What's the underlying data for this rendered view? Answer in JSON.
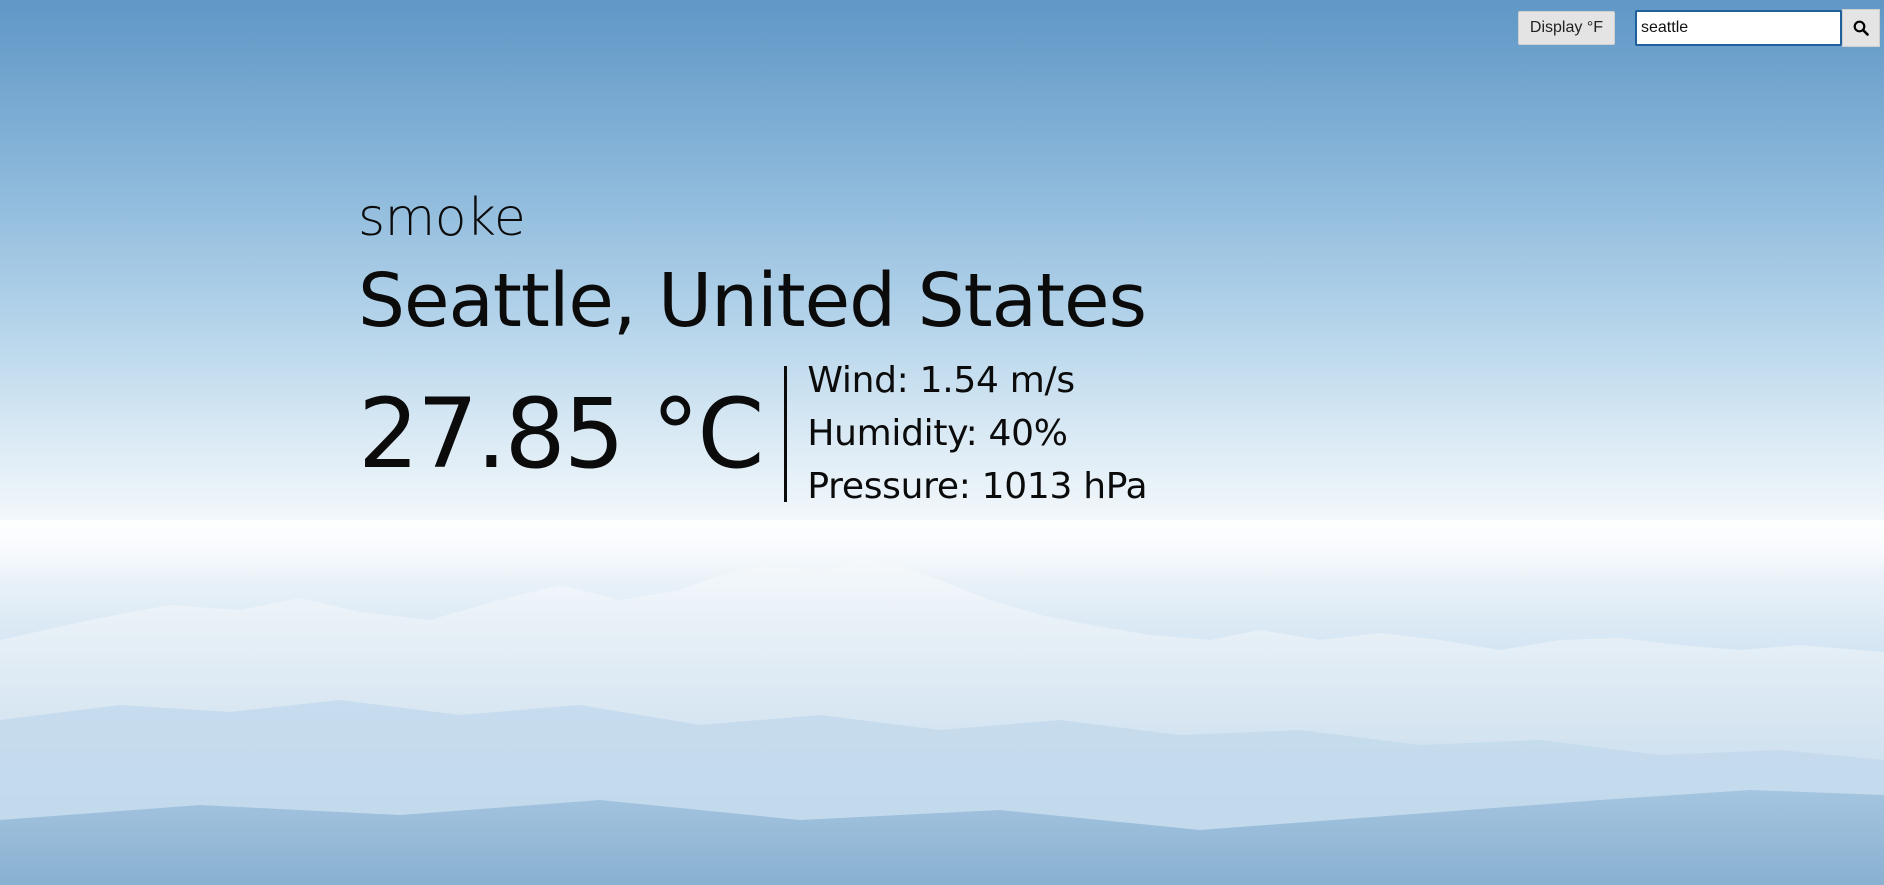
{
  "toolbar": {
    "unit_toggle_label": "Display °F",
    "search_value": "seattle",
    "search_icon": "search-icon"
  },
  "weather": {
    "condition": "smoke",
    "location": "Seattle, United States",
    "temperature": "27.85 °C",
    "wind": "Wind: 1.54 m/s",
    "humidity": "Humidity: 40%",
    "pressure": "Pressure: 1013 hPa"
  },
  "colors": {
    "sky_top": "#5f97c6",
    "horizon": "#f5f9fc",
    "text": "#0b0b0b",
    "search_border": "#1f5f9c"
  }
}
